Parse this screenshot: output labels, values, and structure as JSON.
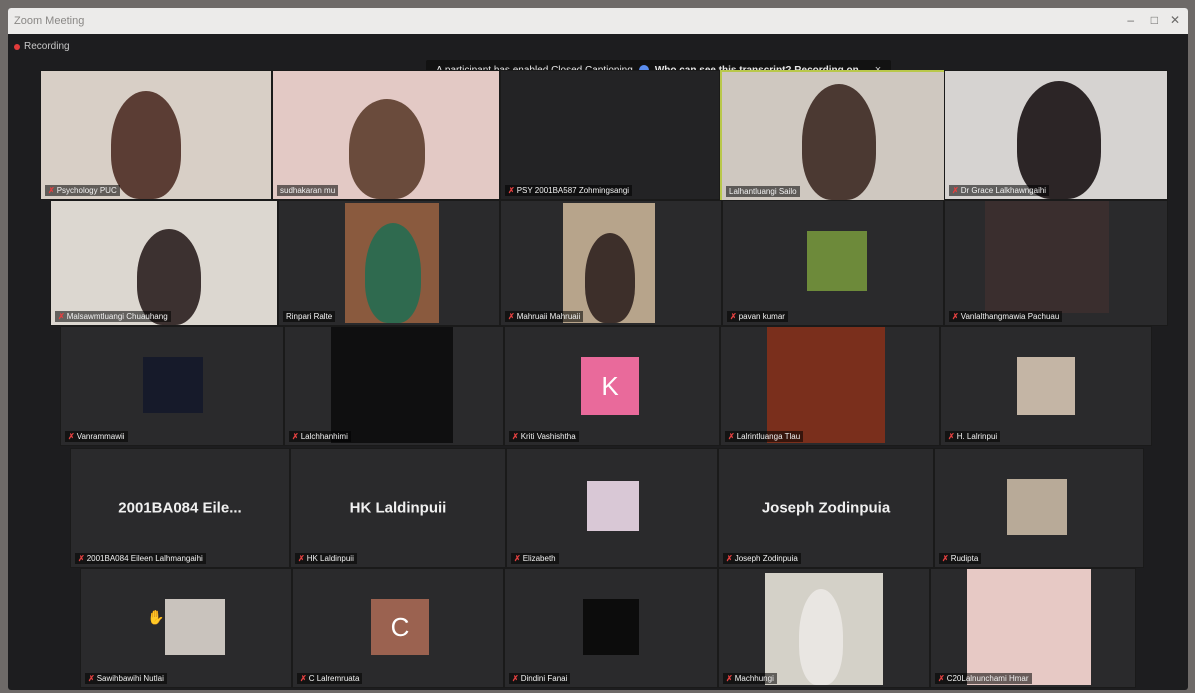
{
  "window": {
    "title": "Zoom Meeting"
  },
  "recording": {
    "label": "Recording"
  },
  "caption_banner": {
    "message": "A participant has enabled Closed Captioning",
    "link": "Who can see this transcript? Recording on",
    "close": "×"
  },
  "participants": [
    {
      "name": "Psychology PUC",
      "muted": true
    },
    {
      "name": "sudhakaran mu",
      "muted": false
    },
    {
      "name": "PSY 2001BA587 Zohmingsangi",
      "muted": true
    },
    {
      "name": "Lalhantluangi Sailo",
      "muted": false,
      "active_speaker": true
    },
    {
      "name": "Dr Grace Lalkhawngaihi",
      "muted": true
    },
    {
      "name": "Malsawmtluangi Chuauhang",
      "muted": true
    },
    {
      "name": "Rinpari Ralte",
      "muted": false
    },
    {
      "name": "Mahruaii Mahruaii",
      "muted": true
    },
    {
      "name": "pavan kumar",
      "muted": true
    },
    {
      "name": "Vanlalthangmawia Pachuau",
      "muted": true
    },
    {
      "name": "Vanrammawii",
      "muted": true
    },
    {
      "name": "Lalchhanhimi",
      "muted": true
    },
    {
      "name": "Kriti Vashishtha",
      "muted": true,
      "avatar_letter": "K",
      "avatar_color": "#e96a9b"
    },
    {
      "name": "Lalrintluanga Tlau",
      "muted": true
    },
    {
      "name": "H. Lalrinpui",
      "muted": true
    },
    {
      "name": "2001BA084 Eileen Lalhmangaihi",
      "muted": true,
      "display_name": "2001BA084  Eile..."
    },
    {
      "name": "HK Laldinpuii",
      "muted": true,
      "display_name": "HK Laldinpuii"
    },
    {
      "name": "Elizabeth",
      "muted": true
    },
    {
      "name": "Joseph Zodinpuia",
      "muted": true,
      "display_name": "Joseph Zodinpuia"
    },
    {
      "name": "Rudipta",
      "muted": true
    },
    {
      "name": "Sawihbawihi Nutlai",
      "muted": true
    },
    {
      "name": "C Lalremruata",
      "muted": true,
      "avatar_letter": "C",
      "avatar_color": "#9b6250"
    },
    {
      "name": "Dindini Fanai",
      "muted": true
    },
    {
      "name": "Machhungi",
      "muted": true
    },
    {
      "name": "C20Lalnunchami Hmar",
      "muted": true
    }
  ],
  "colors": {
    "active_speaker_border": "#b9c84a",
    "muted_icon": "#e34040",
    "tile_bg": "#2a2a2c"
  }
}
